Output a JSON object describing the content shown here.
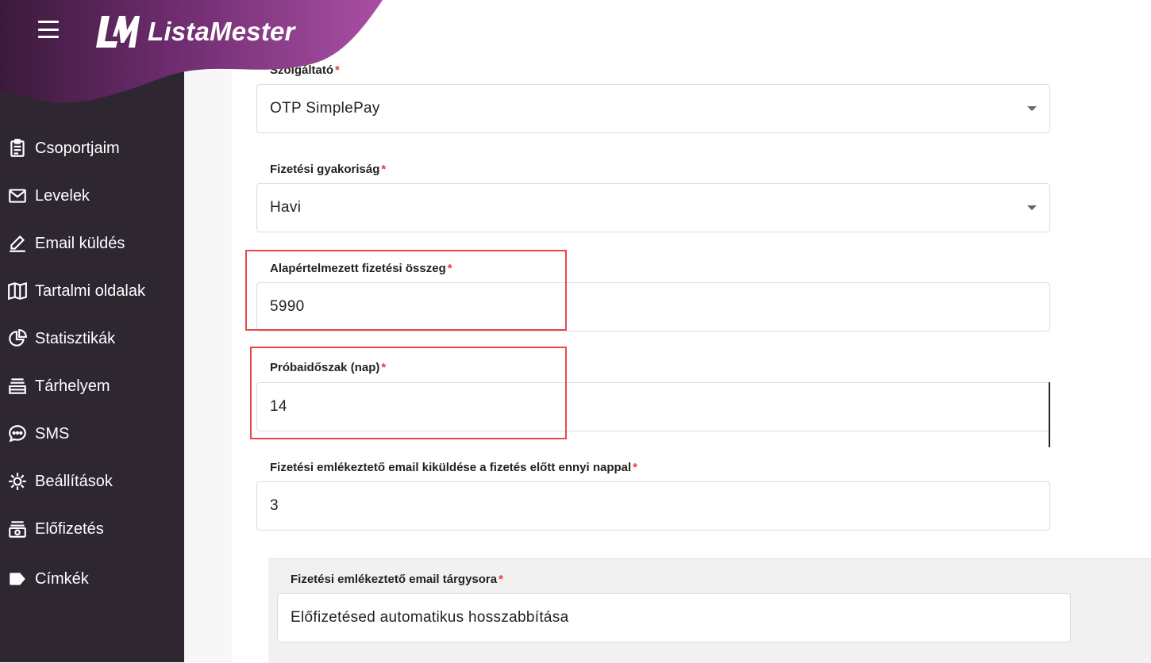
{
  "app": {
    "name": "ListaMester"
  },
  "sidebar": {
    "items": [
      {
        "label": "Csoportjaim",
        "icon": "clipboard-icon"
      },
      {
        "label": "Levelek",
        "icon": "envelope-icon"
      },
      {
        "label": "Email küldés",
        "icon": "pencil-icon"
      },
      {
        "label": "Tartalmi oldalak",
        "icon": "book-icon"
      },
      {
        "label": "Statisztikák",
        "icon": "pie-chart-icon"
      },
      {
        "label": "Tárhelyem",
        "icon": "storage-icon"
      },
      {
        "label": "SMS",
        "icon": "chat-bubble-icon"
      },
      {
        "label": "Beállítások",
        "icon": "gear-icon"
      },
      {
        "label": "Előfizetés",
        "icon": "subscription-icon"
      },
      {
        "label": "Címkék",
        "icon": "tag-icon"
      }
    ]
  },
  "form": {
    "provider": {
      "label": "Szolgáltató",
      "value": "OTP SimplePay"
    },
    "frequency": {
      "label": "Fizetési gyakoriság",
      "value": "Havi"
    },
    "default_amount": {
      "label": "Alapértelmezett fizetési összeg",
      "value": "5990"
    },
    "trial_period": {
      "label": "Próbaidőszak (nap)",
      "value": "14"
    },
    "reminder_days": {
      "label": "Fizetési emlékeztető email kiküldése a fizetés előtt ennyi nappal",
      "value": "3"
    },
    "reminder_subject": {
      "label": "Fizetési emlékeztető email tárgysora",
      "value": "Előfizetésed automatikus hosszabbítása"
    },
    "required_marker": "*"
  },
  "colors": {
    "sidebar_bg": "#2e2630",
    "brand_purple": "#9b3f95",
    "highlight_red": "#e8474a",
    "required_red": "#e53935"
  }
}
